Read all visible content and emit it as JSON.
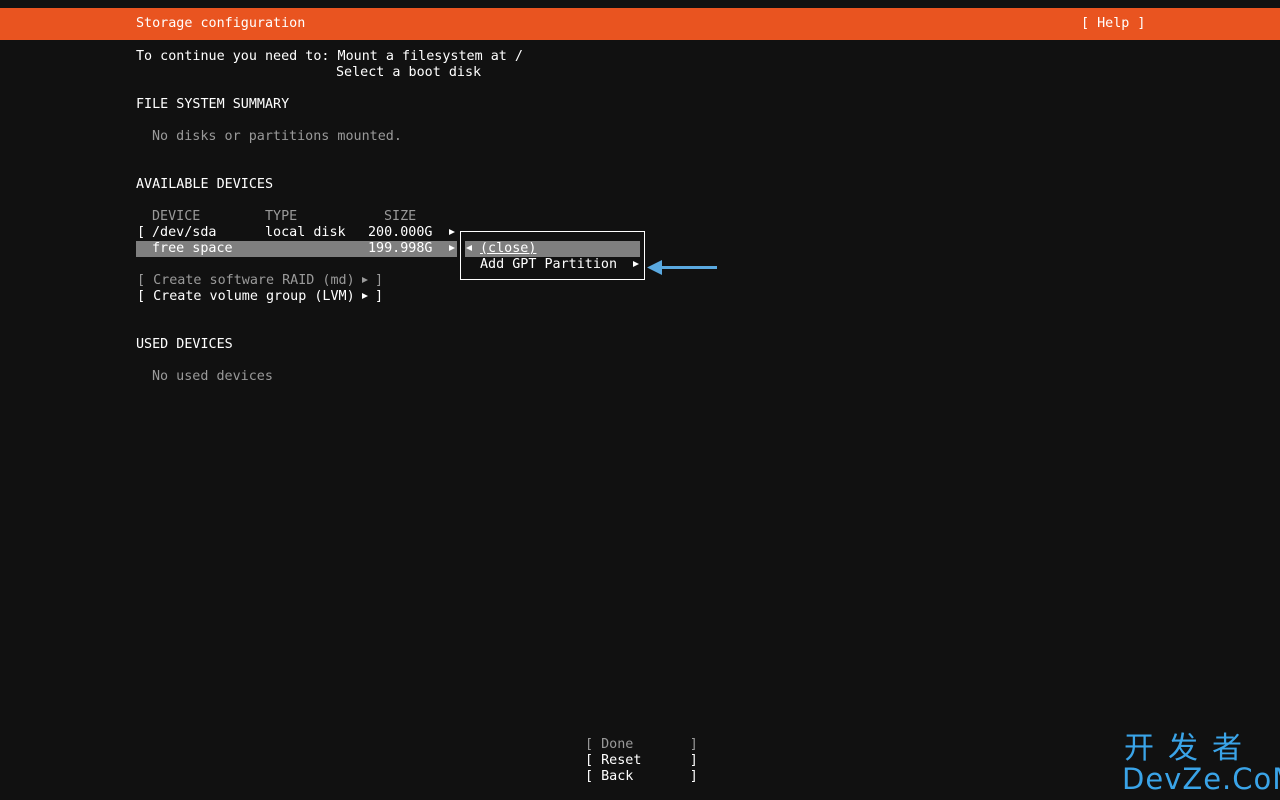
{
  "header": {
    "title": "Storage configuration",
    "help": "[ Help ]"
  },
  "intro": {
    "line1": "To continue you need to: Mount a filesystem at /",
    "line2": "Select a boot disk"
  },
  "file_system_summary": {
    "heading": "FILE SYSTEM SUMMARY",
    "empty_text": "No disks or partitions mounted."
  },
  "available_devices": {
    "heading": "AVAILABLE DEVICES",
    "columns": {
      "device": "DEVICE",
      "type": "TYPE",
      "size": "SIZE"
    },
    "rows": [
      {
        "bracket": "[",
        "device": "/dev/sda",
        "type": "local disk",
        "size": "200.000G"
      },
      {
        "bracket": "",
        "device": "free space",
        "type": "",
        "size": "199.998G"
      }
    ],
    "actions": [
      {
        "label": "[ Create software RAID (md)",
        "close": "]",
        "enabled": false
      },
      {
        "label": "[ Create volume group (LVM)",
        "close": "]",
        "enabled": true
      }
    ]
  },
  "popup_menu": {
    "items": [
      {
        "label": "(close)"
      },
      {
        "label": "Add GPT Partition"
      }
    ]
  },
  "used_devices": {
    "heading": "USED DEVICES",
    "empty_text": "No used devices"
  },
  "footer": {
    "done": "[ Done       ]",
    "reset": "[ Reset      ]",
    "back": "[ Back       ]"
  },
  "watermark": {
    "line1": "开发者",
    "line2": "DevZe.CoM"
  },
  "colors": {
    "header_bg": "#e95420",
    "background": "#111111",
    "highlight": "#7f7f7f",
    "dim_text": "#9a9a9a",
    "annotation_arrow": "#5aa9e0"
  }
}
